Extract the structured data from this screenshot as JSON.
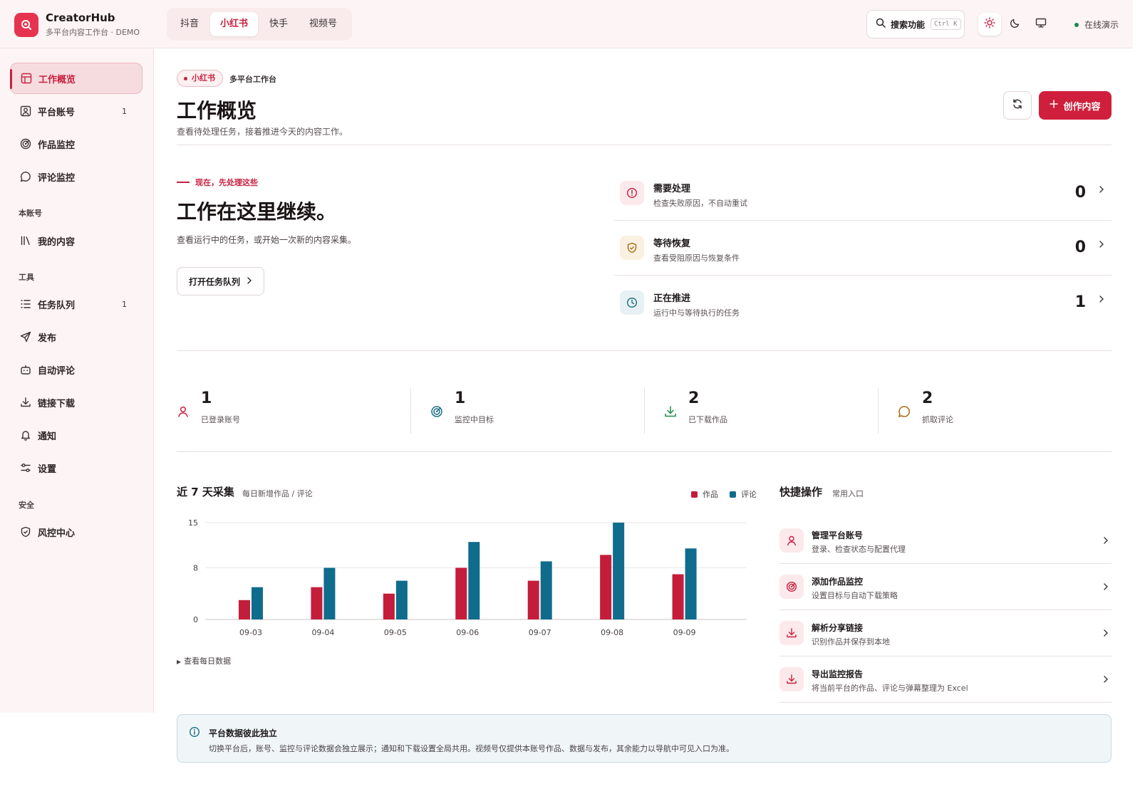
{
  "brand": {
    "name": "CreatorHub",
    "subtitle": "多平台内容工作台 · DEMO"
  },
  "platform_tabs": [
    {
      "label": "抖音",
      "active": false
    },
    {
      "label": "小红书",
      "active": true
    },
    {
      "label": "快手",
      "active": false
    },
    {
      "label": "视频号",
      "active": false
    }
  ],
  "search": {
    "label": "搜索功能",
    "shortcut": "Ctrl K",
    "icon": "search-icon"
  },
  "theme": {
    "options": [
      "sun-icon",
      "moon-icon",
      "monitor-icon"
    ],
    "active": "sun-icon"
  },
  "status": {
    "label": "在线演示",
    "color": "#1f8a4c"
  },
  "sidebar": {
    "items": [
      {
        "label": "工作概览",
        "icon": "layout-icon",
        "active": true,
        "badge": ""
      },
      {
        "label": "平台账号",
        "icon": "user-square-icon",
        "badge": "1"
      },
      {
        "label": "作品监控",
        "icon": "radar-icon",
        "badge": ""
      },
      {
        "label": "评论监控",
        "icon": "comment-icon",
        "badge": ""
      }
    ],
    "sections": [
      {
        "title": "本账号",
        "items": [
          {
            "label": "我的内容",
            "icon": "library-icon",
            "badge": ""
          }
        ]
      },
      {
        "title": "工具",
        "items": [
          {
            "label": "任务队列",
            "icon": "list-icon",
            "badge": "1"
          },
          {
            "label": "发布",
            "icon": "send-icon",
            "badge": ""
          },
          {
            "label": "自动评论",
            "icon": "bot-icon",
            "badge": ""
          },
          {
            "label": "链接下载",
            "icon": "download-icon",
            "badge": ""
          },
          {
            "label": "通知",
            "icon": "bell-icon",
            "badge": ""
          },
          {
            "label": "设置",
            "icon": "sliders-icon",
            "badge": ""
          }
        ]
      },
      {
        "title": "安全",
        "items": [
          {
            "label": "风控中心",
            "icon": "shield-icon",
            "badge": ""
          }
        ]
      }
    ]
  },
  "header": {
    "chip": "小红书",
    "crumb": "多平台工作台",
    "title": "工作概览",
    "description": "查看待处理任务，接着推进今天的内容工作。",
    "create_label": "创作内容"
  },
  "hero": {
    "eyebrow": "现在，先处理这些",
    "title": "工作在这里继续。",
    "description": "查看运行中的任务，或开始一次新的内容采集。",
    "button": "打开任务队列"
  },
  "tasks": [
    {
      "title": "需要处理",
      "subtitle": "检查失败原因，不自动重试",
      "count": "0",
      "icon": "alert-circle-icon",
      "color": "#c8203f",
      "bg": "#fbe9eb"
    },
    {
      "title": "等待恢复",
      "subtitle": "查看受阻原因与恢复条件",
      "count": "0",
      "icon": "shield-check-icon",
      "color": "#a96a10",
      "bg": "#fbf1e2"
    },
    {
      "title": "正在推进",
      "subtitle": "运行中与等待执行的任务",
      "count": "1",
      "icon": "clock-icon",
      "color": "#1c6e86",
      "bg": "#e7f1f4"
    }
  ],
  "stats": [
    {
      "value": "1",
      "label": "已登录账号",
      "icon": "user-icon",
      "color": "#c8203f"
    },
    {
      "value": "1",
      "label": "监控中目标",
      "icon": "radar-icon",
      "color": "#1c6e86"
    },
    {
      "value": "2",
      "label": "已下载作品",
      "icon": "download-icon",
      "color": "#1f8a4c"
    },
    {
      "value": "2",
      "label": "抓取评论",
      "icon": "comment-icon",
      "color": "#a96a10"
    }
  ],
  "chart_section": {
    "title": "近 7 天采集",
    "subtitle": "每日新增作品 / 评论",
    "details_label": "查看每日数据"
  },
  "chart_data": {
    "type": "bar",
    "categories": [
      "09-03",
      "09-04",
      "09-05",
      "09-06",
      "09-07",
      "09-08",
      "09-09"
    ],
    "series": [
      {
        "name": "作品",
        "values": [
          3,
          5,
          4,
          8,
          6,
          10,
          7
        ],
        "color": "#c41d3b"
      },
      {
        "name": "评论",
        "values": [
          5,
          8,
          6,
          12,
          9,
          15,
          11
        ],
        "color": "#0f6c8c"
      }
    ],
    "yticks": [
      0,
      8,
      15
    ],
    "ylim": [
      0,
      15
    ],
    "grid": true,
    "legend": "top-right"
  },
  "quick_actions": {
    "title": "快捷操作",
    "subtitle": "常用入口",
    "items": [
      {
        "title": "管理平台账号",
        "subtitle": "登录、检查状态与配置代理",
        "icon": "user-icon"
      },
      {
        "title": "添加作品监控",
        "subtitle": "设置目标与自动下载策略",
        "icon": "radar-icon"
      },
      {
        "title": "解析分享链接",
        "subtitle": "识别作品并保存到本地",
        "icon": "download-icon"
      },
      {
        "title": "导出监控报告",
        "subtitle": "将当前平台的作品、评论与弹幕整理为 Excel",
        "icon": "download-icon"
      }
    ]
  },
  "notice": {
    "title": "平台数据彼此独立",
    "body": "切换平台后，账号、监控与评论数据会独立展示；通知和下载设置全局共用。视频号仅提供本账号作品、数据与发布，其余能力以导航中可见入口为准。",
    "icon": "info-icon"
  }
}
